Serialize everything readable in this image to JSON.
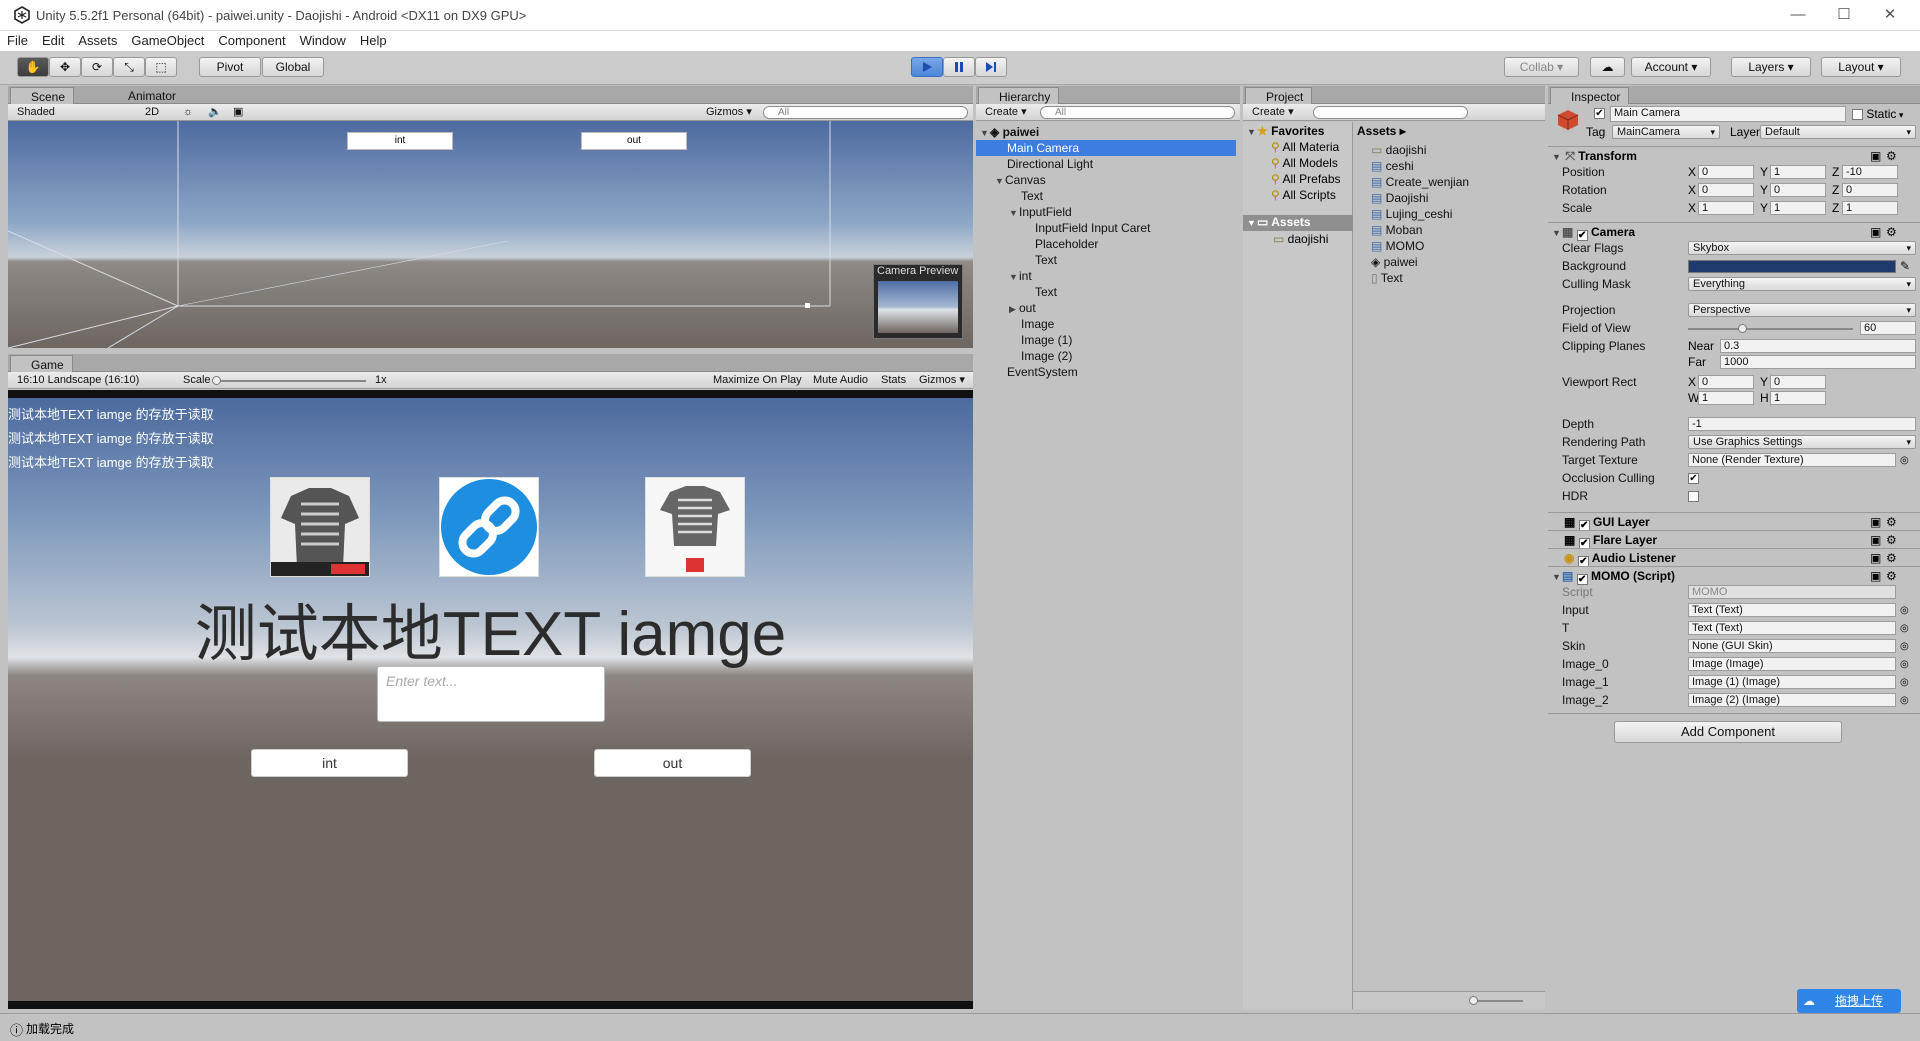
{
  "window": {
    "title": "Unity 5.5.2f1 Personal (64bit) - paiwei.unity - Daojishi - Android <DX11 on DX9 GPU>",
    "minimize": "—",
    "maximize": "☐",
    "close": "✕"
  },
  "menu": [
    "File",
    "Edit",
    "Assets",
    "GameObject",
    "Component",
    "Window",
    "Help"
  ],
  "toolbar": {
    "pivot": "Pivot",
    "global": "Global",
    "collab": "Collab ▾",
    "account": "Account ▾",
    "layers": "Layers ▾",
    "layout": "Layout ▾"
  },
  "scene": {
    "tab": "Scene",
    "tab2": "Animator",
    "shading": "Shaded",
    "mode2d": "2D",
    "gizmos": "Gizmos ▾",
    "search": "All",
    "btn_int": "int",
    "btn_out": "out",
    "camera_preview": "Camera Preview"
  },
  "game": {
    "tab": "Game",
    "aspect": "16:10 Landscape (16:10)",
    "scale_label": "Scale",
    "scale_value": "1x",
    "maximize": "Maximize On Play",
    "mute": "Mute Audio",
    "stats": "Stats",
    "gizmos": "Gizmos ▾",
    "log_lines": [
      "测试本地TEXT  iamge 的存放于读取",
      "测试本地TEXT  iamge 的存放于读取",
      "测试本地TEXT  iamge 的存放于读取"
    ],
    "big_text": "测试本地TEXT  iamge",
    "input_placeholder": "Enter text...",
    "btn_int": "int",
    "btn_out": "out"
  },
  "hierarchy": {
    "tab": "Hierarchy",
    "create": "Create ▾",
    "search": "All",
    "scene": "paiwei",
    "items": [
      "Main Camera",
      "Directional Light",
      "Canvas",
      "Text",
      "InputField",
      "InputField Input Caret",
      "Placeholder",
      "Text",
      "int",
      "Text",
      "out",
      "Image",
      "Image (1)",
      "Image (2)",
      "EventSystem"
    ]
  },
  "project": {
    "tab": "Project",
    "create": "Create ▾",
    "favorites": "Favorites",
    "fav_items": [
      "All Materia",
      "All Models",
      "All Prefabs",
      "All Scripts"
    ],
    "assets_root": "Assets",
    "assets_child": "daojishi",
    "breadcrumb": "Assets ▸",
    "assets": [
      "daojishi",
      "ceshi",
      "Create_wenjian",
      "Daojishi",
      "Lujing_ceshi",
      "Moban",
      "MOMO",
      "paiwei",
      "Text"
    ]
  },
  "inspector": {
    "tab": "Inspector",
    "object_name": "Main Camera",
    "static": "Static",
    "tag_label": "Tag",
    "tag": "MainCamera",
    "layer_label": "Layer",
    "layer": "Default",
    "transform": {
      "title": "Transform",
      "position": [
        "0",
        "1",
        "-10"
      ],
      "rotation": [
        "0",
        "0",
        "0"
      ],
      "scale": [
        "1",
        "1",
        "1"
      ],
      "pos_label": "Position",
      "rot_label": "Rotation",
      "scale_label": "Scale"
    },
    "camera": {
      "title": "Camera",
      "clear_flags_label": "Clear Flags",
      "clear_flags": "Skybox",
      "background_label": "Background",
      "culling_label": "Culling Mask",
      "culling": "Everything",
      "projection_label": "Projection",
      "projection": "Perspective",
      "fov_label": "Field of View",
      "fov": "60",
      "clip_label": "Clipping Planes",
      "near_label": "Near",
      "near": "0.3",
      "far_label": "Far",
      "far": "1000",
      "viewport_label": "Viewport Rect",
      "vp_x": "0",
      "vp_y": "0",
      "vp_w": "1",
      "vp_h": "1",
      "depth_label": "Depth",
      "depth": "-1",
      "render_label": "Rendering Path",
      "render": "Use Graphics Settings",
      "target_label": "Target Texture",
      "target": "None (Render Texture)",
      "occlusion_label": "Occlusion Culling",
      "hdr_label": "HDR"
    },
    "gui_layer": "GUI Layer",
    "flare_layer": "Flare Layer",
    "audio_listener": "Audio Listener",
    "momo": {
      "title": "MOMO (Script)",
      "script_label": "Script",
      "script": "MOMO",
      "input_label": "Input",
      "input": "Text (Text)",
      "t_label": "T",
      "t": "Text (Text)",
      "skin_label": "Skin",
      "skin": "None (GUI Skin)",
      "img0_label": "Image_0",
      "img0": "Image (Image)",
      "img1_label": "Image_1",
      "img1": "Image (1) (Image)",
      "img2_label": "Image_2",
      "img2": "Image (2) (Image)"
    },
    "add_component": "Add Component"
  },
  "status": {
    "text": "加载完成"
  },
  "upload": {
    "label": "拖拽上传"
  },
  "colors": {
    "selection": "#3e7de0",
    "camera_bg": "#1f3b6e",
    "sky_top": "#5f7fb0",
    "ground": "#6d6560"
  }
}
